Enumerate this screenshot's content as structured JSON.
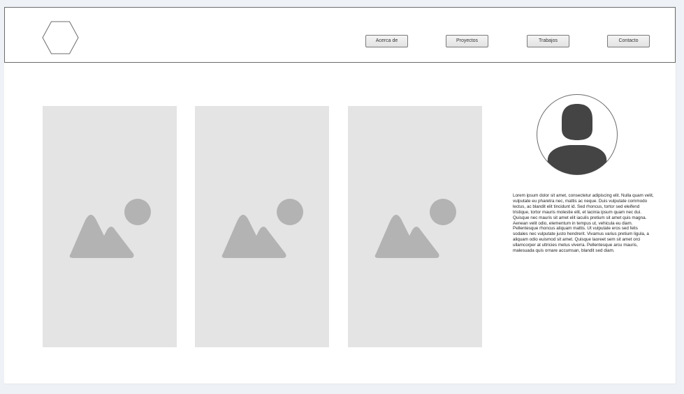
{
  "header": {
    "logo_icon": "hexagon-logo-icon",
    "nav": [
      {
        "label": "Acerca de"
      },
      {
        "label": "Proyectos"
      },
      {
        "label": "Trabajos"
      },
      {
        "label": "Contacto"
      }
    ]
  },
  "gallery": {
    "items": [
      {
        "icon": "image-placeholder-icon"
      },
      {
        "icon": "image-placeholder-icon"
      },
      {
        "icon": "image-placeholder-icon"
      }
    ]
  },
  "profile": {
    "avatar_icon": "user-avatar-icon",
    "bio": "Lorem ipsum dolor sit amet, consectetur adipiscing elit. Nulla quam velit, vulputate eu pharetra nec, mattis ac neque. Duis vulputate commodo lectus, ac blandit elit tincidunt id. Sed rhoncus, tortor sed eleifend tristique, tortor mauris molestie elit, et lacinia ipsum quam nec dui. Quisque nec mauris sit amet elit iaculis pretium sit amet quis magna. Aenean velit odio, elementum in tempus ut, vehicula eu diam. Pellentesque rhoncus aliquam mattis. Ut vulputate eros sed felis sodales nec vulputate justo hendrerit. Vivamus varius pretium ligula, a aliquam odio euismod sit amet. Quisque laoreet sem sit amet orci ullamcorper at ultricies metus viverra. Pellentesque arcu mauris, malesuada quis ornare accumsan, blandit sed diam."
  },
  "colors": {
    "page_background": "#eef1f6",
    "canvas": "#ffffff",
    "placeholder_fill": "#e4e4e4",
    "placeholder_icon": "#b3b3b3",
    "avatar_fill": "#444444"
  }
}
